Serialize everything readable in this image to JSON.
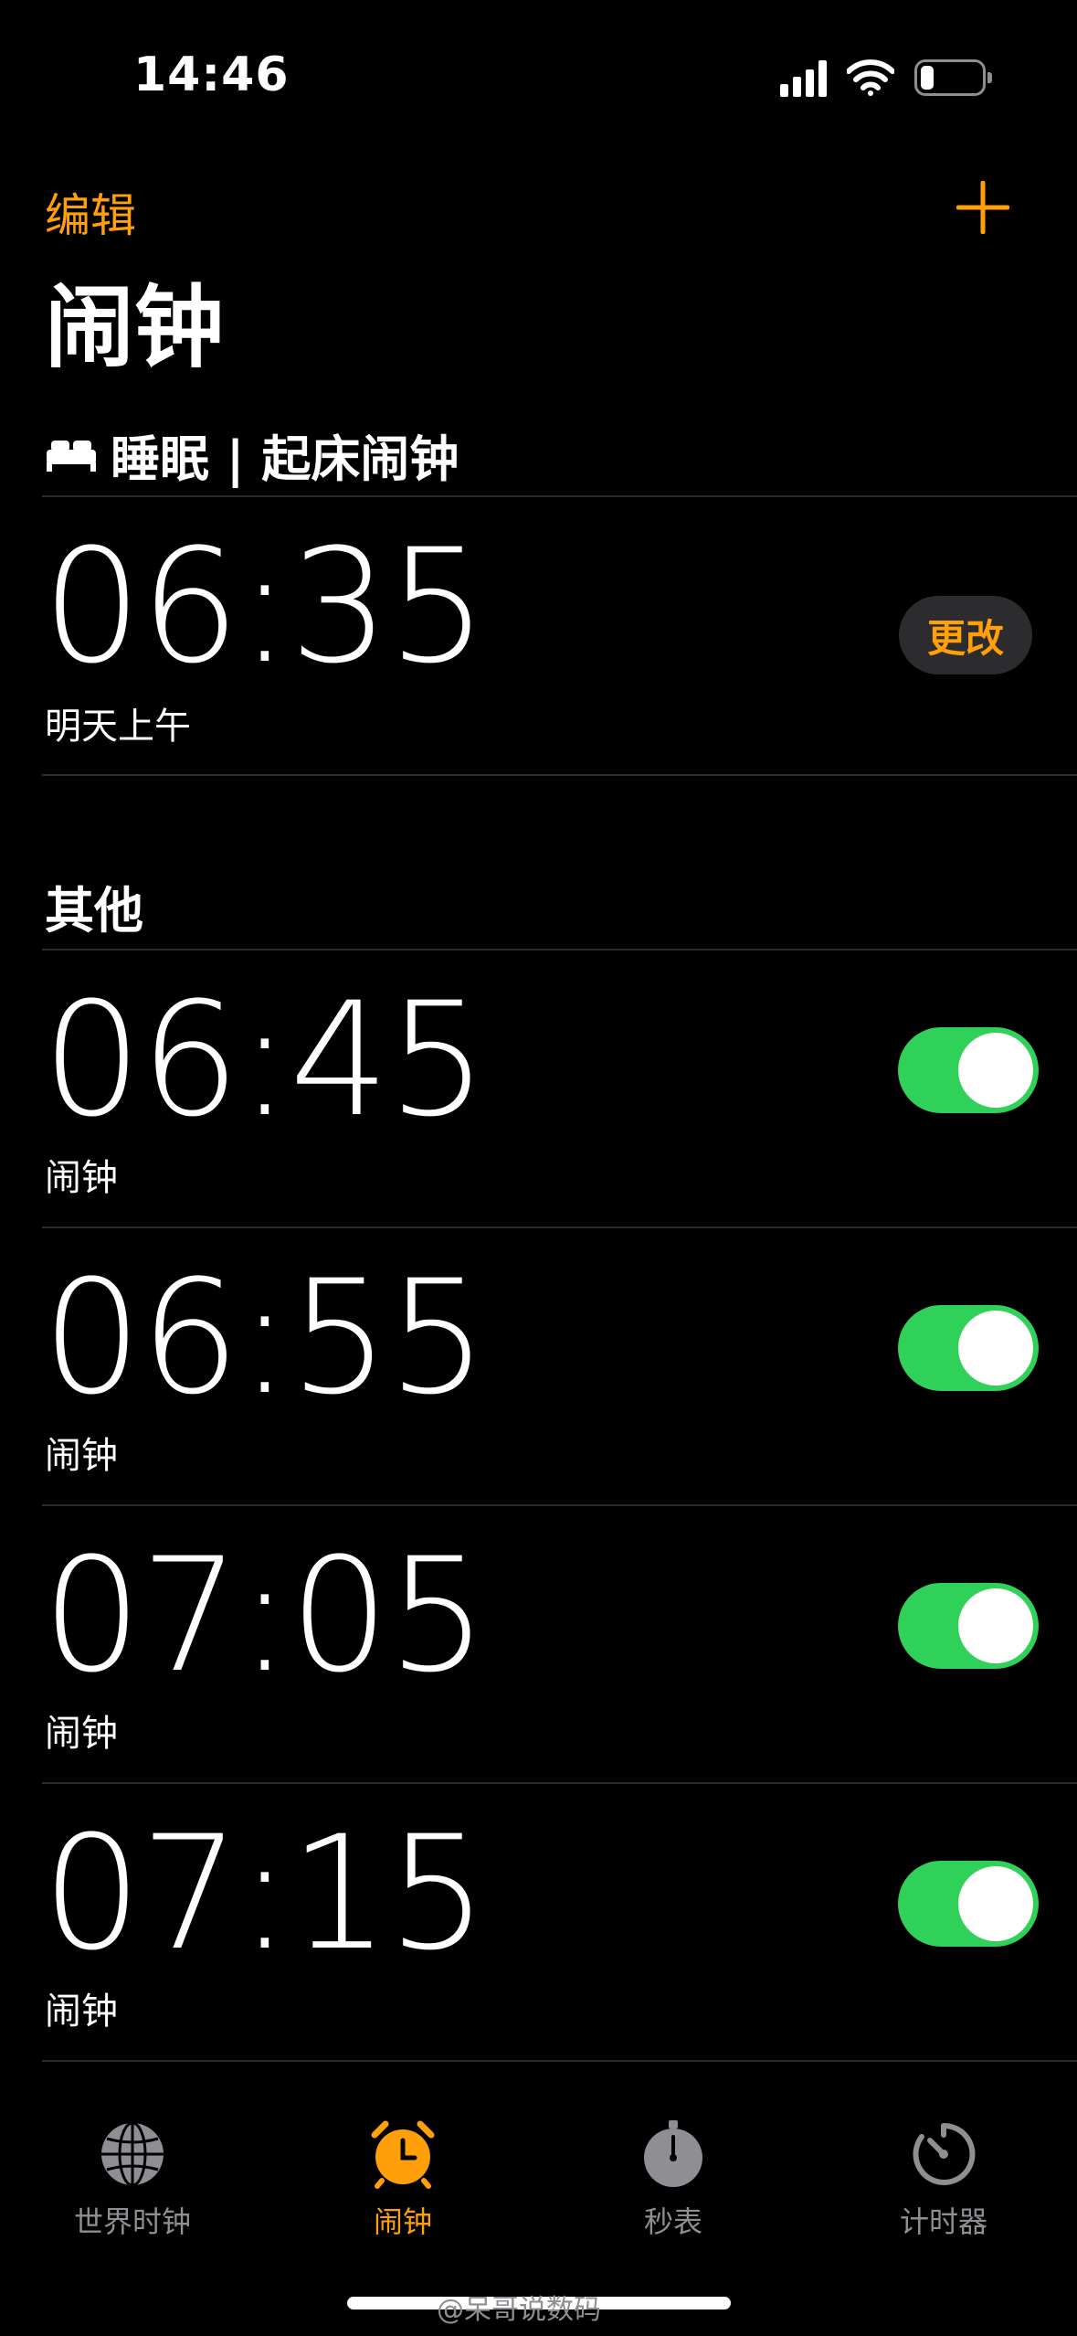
{
  "status_bar": {
    "time": "14:46"
  },
  "nav": {
    "edit_label": "编辑"
  },
  "page": {
    "title": "闹钟"
  },
  "sleep_section": {
    "header": "睡眠 | 起床闹钟",
    "alarm": {
      "time": "06:35",
      "subtitle": "明天上午",
      "change_label": "更改"
    }
  },
  "other_section": {
    "header": "其他",
    "alarms": [
      {
        "time": "06:45",
        "label": "闹钟",
        "enabled": true
      },
      {
        "time": "06:55",
        "label": "闹钟",
        "enabled": true
      },
      {
        "time": "07:05",
        "label": "闹钟",
        "enabled": true
      },
      {
        "time": "07:15",
        "label": "闹钟",
        "enabled": true
      }
    ]
  },
  "tab_bar": {
    "tabs": [
      {
        "label": "世界时钟",
        "icon": "globe-icon"
      },
      {
        "label": "闹钟",
        "icon": "alarm-clock-icon",
        "active": true
      },
      {
        "label": "秒表",
        "icon": "stopwatch-icon"
      },
      {
        "label": "计时器",
        "icon": "timer-icon"
      }
    ]
  },
  "watermark": "@呆哥说数码",
  "colors": {
    "accent": "#ff9f0a",
    "toggle_on": "#30d158",
    "background": "#000000",
    "secondary": "#8e8e93"
  }
}
